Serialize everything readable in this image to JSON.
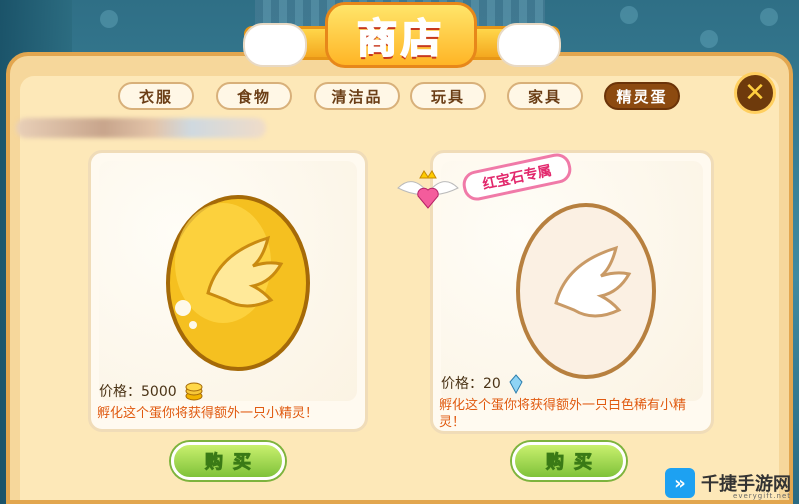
{
  "title": "商店",
  "tabs": [
    {
      "label": "衣服",
      "active": false
    },
    {
      "label": "食物",
      "active": false
    },
    {
      "label": "清洁品",
      "active": false
    },
    {
      "label": "玩具",
      "active": false
    },
    {
      "label": "家具",
      "active": false
    },
    {
      "label": "精灵蛋",
      "active": true
    }
  ],
  "items": [
    {
      "price_label": "价格：",
      "price_value": "5000",
      "currency_icon": "gold-coin-icon",
      "description": "孵化这个蛋你将获得额外一只小精灵！",
      "buy_label": "购买",
      "egg_color": "#f2b400"
    },
    {
      "exclusive_label": "红宝石专属",
      "price_label": "价格：",
      "price_value": "20",
      "currency_icon": "blue-gem-icon",
      "description": "孵化这个蛋你将获得额外一只白色稀有小精灵！",
      "buy_label": "购买",
      "egg_color": "#fbefe0"
    }
  ],
  "close_icon": "close-x-icon",
  "watermark": {
    "text": "千捷手游网",
    "sub": "everygift.net"
  }
}
